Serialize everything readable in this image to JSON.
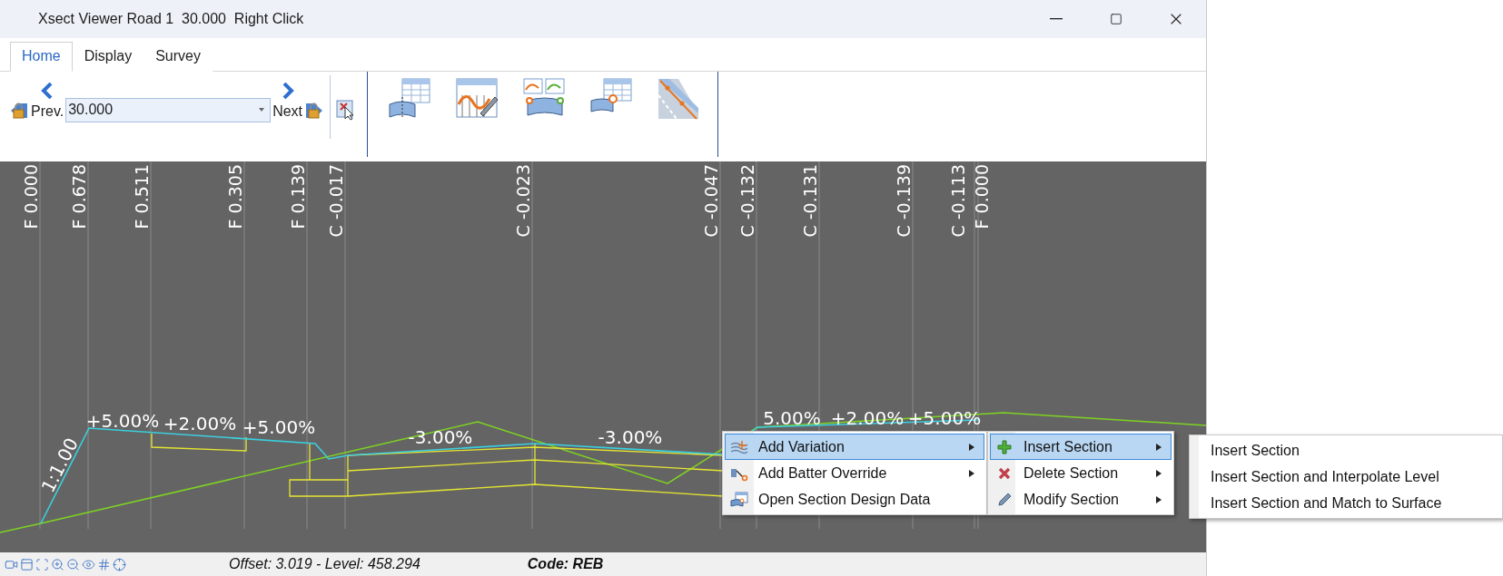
{
  "window": {
    "title": "Xsect Viewer Road 1  30.000  Right Click"
  },
  "tabs": [
    {
      "label": "Home",
      "selected": true
    },
    {
      "label": "Display",
      "selected": false
    },
    {
      "label": "Survey",
      "selected": false
    }
  ],
  "ribbon": {
    "prev_label": "Prev.",
    "chainage": "30.000",
    "next_label": "Next"
  },
  "section_view": {
    "offset_labels": [
      "F 0.000",
      "F 0.678",
      "F 0.511",
      "F 0.305",
      "F 0.139",
      "C -0.017",
      "C -0.023",
      "C -0.047",
      "C -0.132",
      "C -0.131",
      "C -0.139",
      "C -0.113",
      "F 0.000"
    ],
    "grade_labels": [
      "+5.00%",
      "+2.00%",
      "+5.00%",
      "-3.00%",
      "-3.00%",
      "5.00%",
      "+2.00%",
      "+5.00%"
    ],
    "batter_label": "1:1.00"
  },
  "context_menu": [
    {
      "label": "Add Variation",
      "kind": "variation",
      "selected": true,
      "has_submenu": true
    },
    {
      "label": "Add Batter Override",
      "kind": "batter",
      "selected": false,
      "has_submenu": true
    },
    {
      "label": "Open Section Design Data",
      "kind": "design-data",
      "selected": false,
      "has_submenu": false
    }
  ],
  "submenu": [
    {
      "label": "Insert Section",
      "kind": "insert",
      "selected": true,
      "has_submenu": true
    },
    {
      "label": "Delete Section",
      "kind": "delete",
      "selected": false,
      "has_submenu": true
    },
    {
      "label": "Modify Section",
      "kind": "modify",
      "selected": false,
      "has_submenu": true
    }
  ],
  "insert_submenu": [
    {
      "label": "Insert Section",
      "selected": false
    },
    {
      "label": "Insert Section and Interpolate Level",
      "selected": false
    },
    {
      "label": "Insert Section and Match to Surface",
      "selected": false
    }
  ],
  "status_bar": {
    "position": "Offset: 3.019 - Level: 458.294",
    "code": "Code: REB"
  }
}
